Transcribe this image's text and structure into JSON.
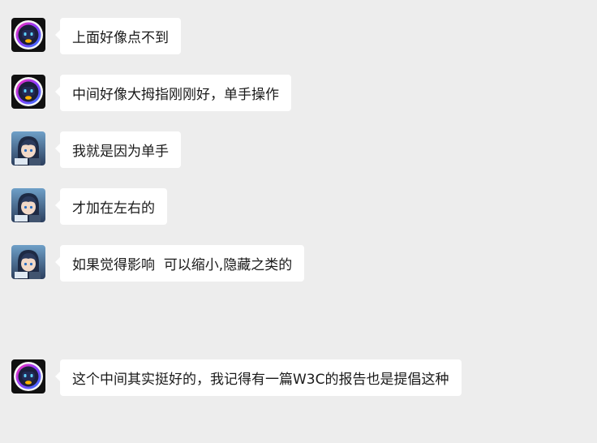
{
  "messages": [
    {
      "sender": "robot",
      "text": "上面好像点不到"
    },
    {
      "sender": "robot",
      "text": "中间好像大拇指刚刚好，单手操作"
    },
    {
      "sender": "anime",
      "text": "我就是因为单手"
    },
    {
      "sender": "anime",
      "text": "才加在左右的"
    },
    {
      "sender": "anime",
      "text": "如果觉得影响  可以缩小,隐藏之类的"
    },
    {
      "sender": "robot",
      "text": "这个中间其实挺好的，我记得有一篇W3C的报告也是提倡这种"
    }
  ],
  "colors": {
    "background": "#ededed",
    "bubble": "#ffffff",
    "text": "#1a1a1a"
  },
  "icons": {
    "robot": "robot-avatar-icon",
    "anime": "anime-hooded-avatar-icon"
  }
}
